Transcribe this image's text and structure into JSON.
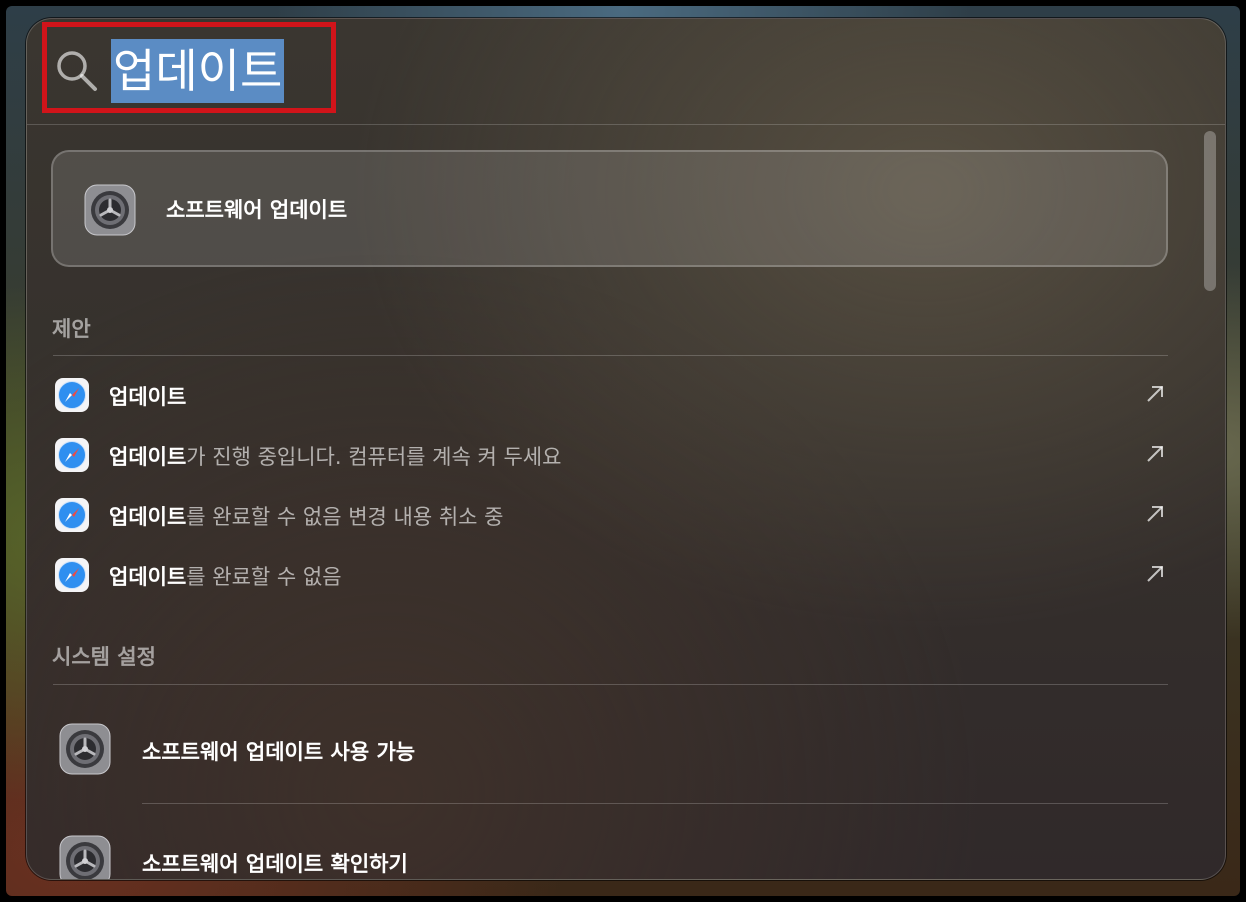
{
  "search": {
    "query": "업데이트"
  },
  "top_hit": {
    "title": "소프트웨어 업데이트",
    "icon": "system-settings-gear-icon"
  },
  "sections": {
    "suggestions": {
      "header": "제안",
      "items": [
        {
          "bold": "업데이트",
          "rest": "",
          "icon": "safari-icon"
        },
        {
          "bold": "업데이트",
          "rest": "가 진행 중입니다. 컴퓨터를 계속 켜 두세요",
          "icon": "safari-icon"
        },
        {
          "bold": "업데이트",
          "rest": "를 완료할 수 없음 변경 내용 취소 중",
          "icon": "safari-icon"
        },
        {
          "bold": "업데이트",
          "rest": "를 완료할 수 없음",
          "icon": "safari-icon"
        }
      ]
    },
    "system_settings": {
      "header": "시스템 설정",
      "items": [
        {
          "title": "소프트웨어 업데이트 사용 가능",
          "icon": "system-settings-gear-icon"
        },
        {
          "title": "소프트웨어 업데이트 확인하기",
          "icon": "system-settings-gear-icon"
        }
      ]
    }
  },
  "colors": {
    "selection": "#5b8cc4",
    "highlight_box": "#d1141a"
  }
}
